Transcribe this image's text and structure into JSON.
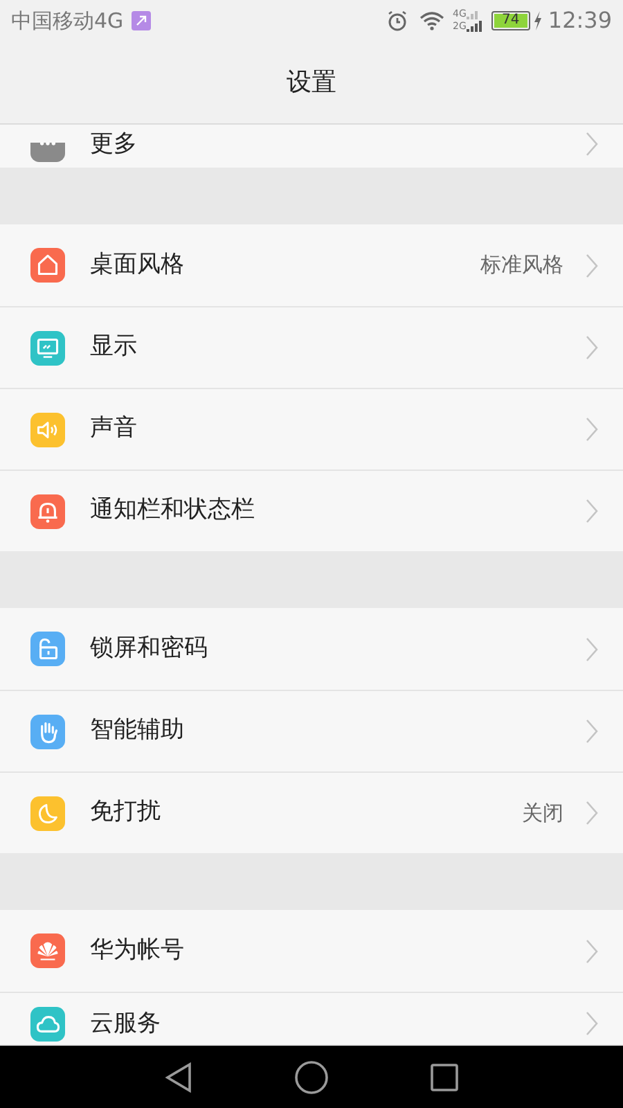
{
  "status_bar": {
    "carrier": "中国移动4G",
    "network_labels": [
      "4G",
      "2G"
    ],
    "battery": "74",
    "time": "12:39"
  },
  "header": {
    "title": "设置"
  },
  "groups": [
    {
      "items": [
        {
          "kind": "more",
          "label": "更多"
        }
      ]
    },
    {
      "items": [
        {
          "kind": "home",
          "label": "桌面风格",
          "value": "标准风格"
        },
        {
          "kind": "display",
          "label": "显示"
        },
        {
          "kind": "sound",
          "label": "声音"
        },
        {
          "kind": "notification",
          "label": "通知栏和状态栏"
        }
      ]
    },
    {
      "items": [
        {
          "kind": "lock",
          "label": "锁屏和密码"
        },
        {
          "kind": "hand",
          "label": "智能辅助"
        },
        {
          "kind": "moon",
          "label": "免打扰",
          "value": "关闭"
        }
      ]
    },
    {
      "items": [
        {
          "kind": "brand",
          "label": "华为帐号"
        },
        {
          "kind": "cloud",
          "label": "云服务"
        }
      ]
    }
  ]
}
